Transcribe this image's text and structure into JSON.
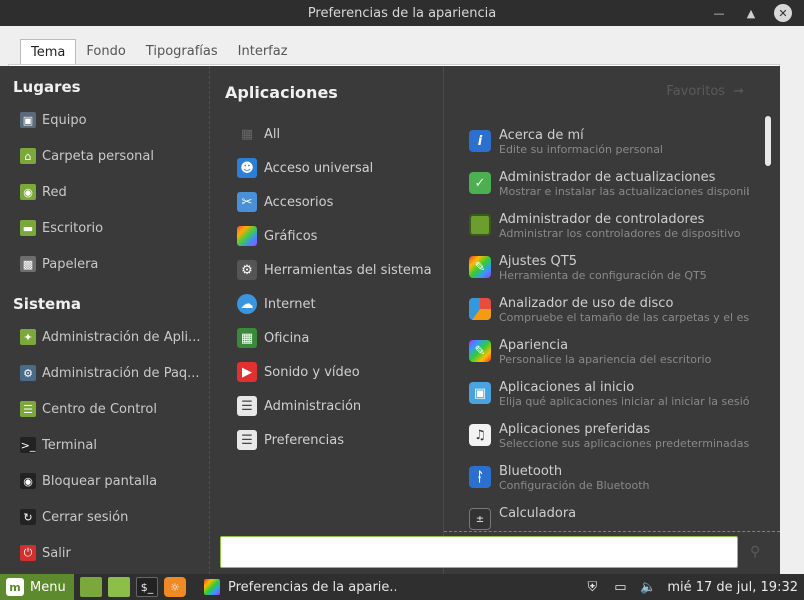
{
  "window": {
    "title": "Preferencias de la apariencia",
    "tabs": [
      {
        "label": "Tema",
        "active": true
      },
      {
        "label": "Fondo"
      },
      {
        "label": "Tipografías"
      },
      {
        "label": "Interfaz"
      }
    ]
  },
  "menu": {
    "places_title": "Lugares",
    "places": [
      {
        "label": "Equipo",
        "icon": "computer-icon"
      },
      {
        "label": "Carpeta personal",
        "icon": "home-folder-icon"
      },
      {
        "label": "Red",
        "icon": "network-folder-icon"
      },
      {
        "label": "Escritorio",
        "icon": "desktop-folder-icon"
      },
      {
        "label": "Papelera",
        "icon": "trash-icon"
      }
    ],
    "system_title": "Sistema",
    "system": [
      {
        "label": "Administración de Apli...",
        "icon": "software-manager-icon"
      },
      {
        "label": "Administración de Paq...",
        "icon": "package-manager-icon"
      },
      {
        "label": "Centro de Control",
        "icon": "control-center-icon"
      },
      {
        "label": "Terminal",
        "icon": "terminal-icon"
      },
      {
        "label": "Bloquear pantalla",
        "icon": "lock-icon"
      },
      {
        "label": "Cerrar sesión",
        "icon": "logout-icon"
      },
      {
        "label": "Salir",
        "icon": "power-icon"
      }
    ],
    "apps_title": "Aplicaciones",
    "favorites_label": "Favoritos",
    "categories": [
      {
        "label": "All",
        "icon": "all-apps-icon"
      },
      {
        "label": "Acceso universal",
        "icon": "accessibility-icon"
      },
      {
        "label": "Accesorios",
        "icon": "accessories-icon"
      },
      {
        "label": "Gráficos",
        "icon": "graphics-icon"
      },
      {
        "label": "Herramientas del sistema",
        "icon": "system-tools-icon"
      },
      {
        "label": "Internet",
        "icon": "internet-icon"
      },
      {
        "label": "Oficina",
        "icon": "office-icon"
      },
      {
        "label": "Sonido y vídeo",
        "icon": "multimedia-icon"
      },
      {
        "label": "Administración",
        "icon": "administration-icon"
      },
      {
        "label": "Preferencias",
        "icon": "preferences-icon"
      }
    ],
    "applications": [
      {
        "name": "Acerca de mí",
        "desc": "Edite su información personal",
        "icon": "info-icon"
      },
      {
        "name": "Administrador de actualizaciones",
        "desc": "Mostrar e instalar las actualizaciones disponibles",
        "icon": "update-shield-icon"
      },
      {
        "name": "Administrador de controladores",
        "desc": "Administrar los controladores de dispositivo",
        "icon": "driver-chip-icon"
      },
      {
        "name": "Ajustes QT5",
        "desc": "Herramienta de configuración de QT5",
        "icon": "qt-settings-icon"
      },
      {
        "name": "Analizador de uso de disco",
        "desc": "Compruebe el tamaño de las carpetas y el espaci",
        "icon": "disk-usage-icon"
      },
      {
        "name": "Apariencia",
        "desc": "Personalice la apariencia del escritorio",
        "icon": "appearance-icon"
      },
      {
        "name": "Aplicaciones al inicio",
        "desc": "Elija qué aplicaciones iniciar al iniciar la sesión",
        "icon": "startup-apps-icon"
      },
      {
        "name": "Aplicaciones preferidas",
        "desc": "Seleccione sus aplicaciones predeterminadas",
        "icon": "preferred-apps-icon"
      },
      {
        "name": "Bluetooth",
        "desc": "Configuración de Bluetooth",
        "icon": "bluetooth-icon"
      },
      {
        "name": "Calculadora",
        "desc": "",
        "icon": "calculator-icon"
      }
    ],
    "search": {
      "value": "",
      "placeholder": ""
    }
  },
  "taskbar": {
    "menu_label": "Menu",
    "window_label": "Preferencias de la aparie...",
    "clock": "mié 17 de jul, 19:32"
  },
  "colors": {
    "accent": "#5d8a2c",
    "menu_bg": "#3a3a3a",
    "panel_bg": "#2f2f2f"
  }
}
